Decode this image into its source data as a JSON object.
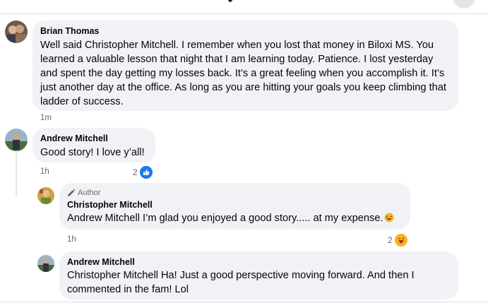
{
  "comments": [
    {
      "author": "Brian Thomas",
      "text": "Well said Christopher Mitchell. I remember when you lost that money in Biloxi MS. You learned a valuable lesson that night that I am learning today. Patience. I lost yesterday and spent the day getting my losses back. It’s a great feeling when you accomplish it. It’s just another day at the office. As long as you are hitting your goals you keep climbing that ladder of success.",
      "time": "1m"
    },
    {
      "author": "Andrew Mitchell",
      "text": "Good story! I love y’all!",
      "time": "1h",
      "reaction_count": "2",
      "reaction_icon": "like-icon",
      "replies": [
        {
          "badge": "Author",
          "author": "Christopher Mitchell",
          "text": "Andrew Mitchell I’m glad you enjoyed a good story..... at my expense.",
          "time": "1h",
          "reaction_count": "2",
          "reaction_icon": "haha-icon"
        },
        {
          "author": "Andrew Mitchell",
          "text": "Christopher Mitchell Ha! Just a good perspective moving forward. And then I commented in the fam! Lol"
        }
      ]
    }
  ],
  "colors": {
    "bubble_bg": "#f0f2f5",
    "meta_text": "#65676b",
    "like_blue": "#1877f2",
    "haha_yellow": "#f7b125"
  }
}
